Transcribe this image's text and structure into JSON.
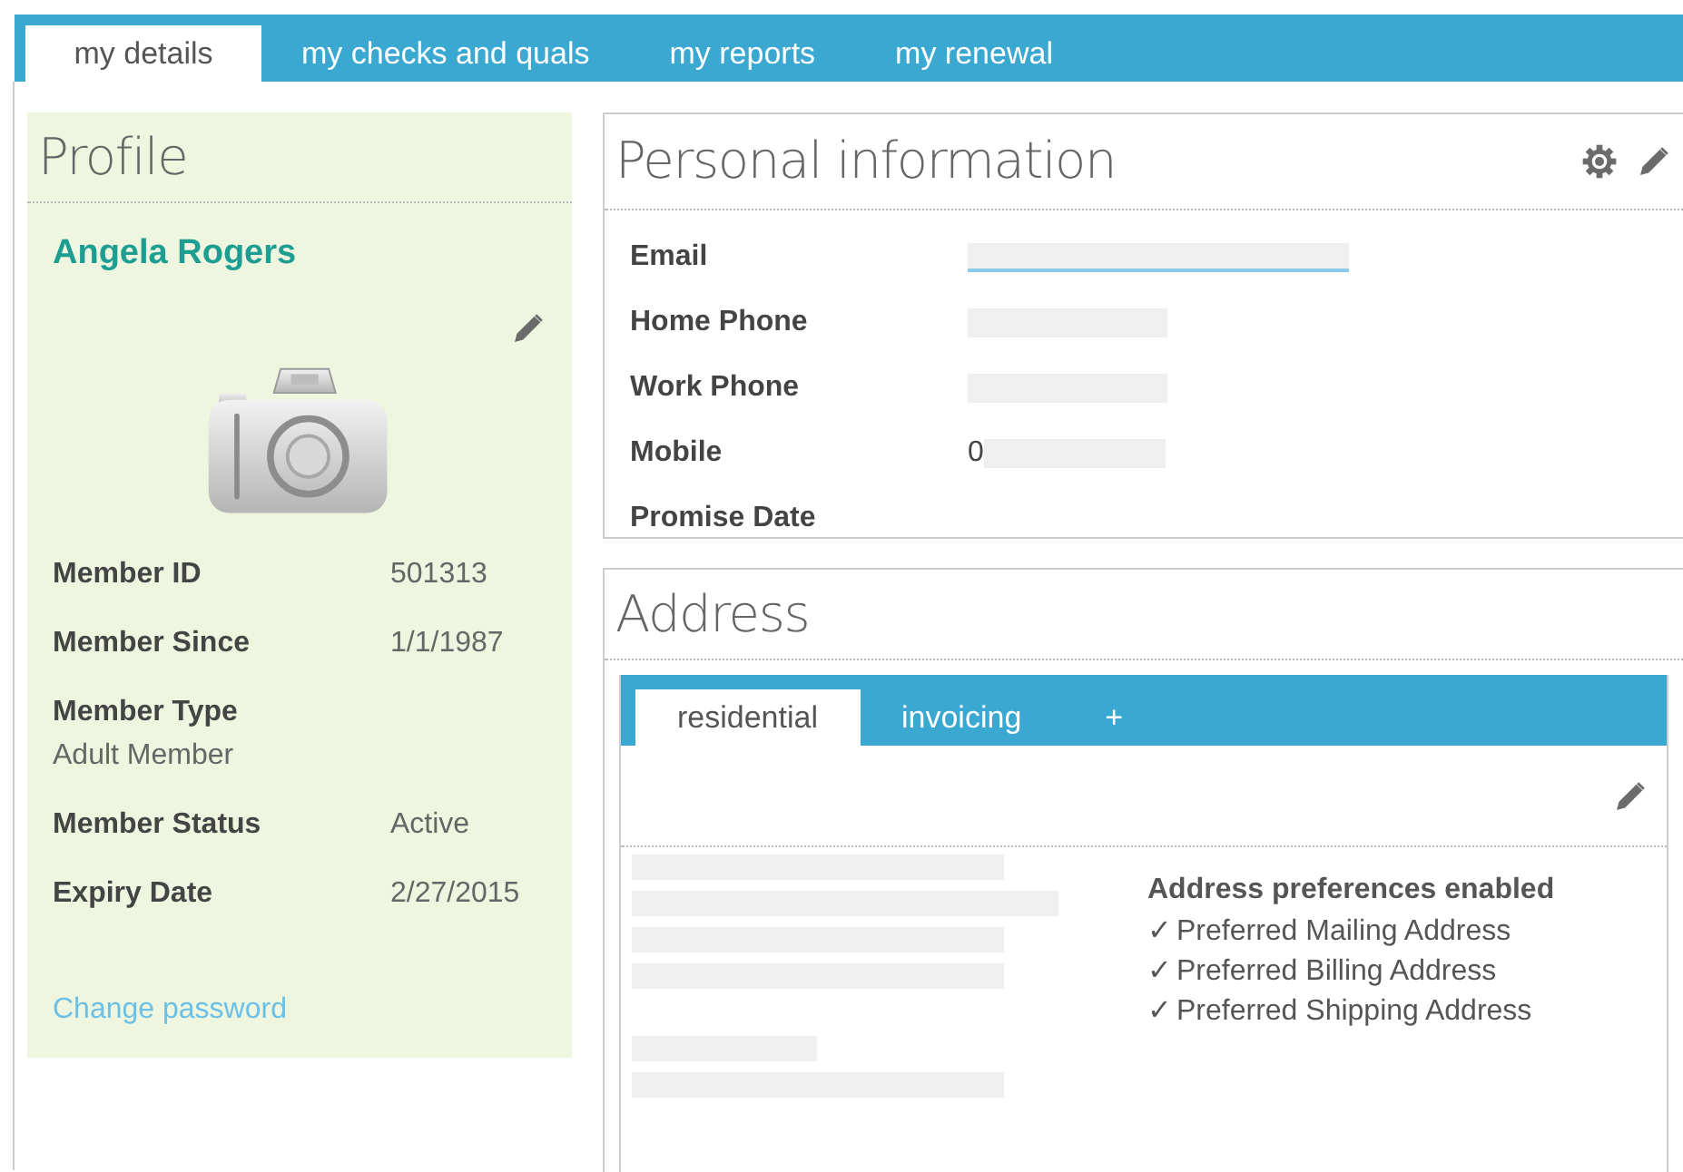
{
  "tabs": [
    {
      "label": "my details",
      "selected": true
    },
    {
      "label": "my checks and quals",
      "selected": false
    },
    {
      "label": "my reports",
      "selected": false
    },
    {
      "label": "my renewal",
      "selected": false
    }
  ],
  "profile": {
    "title": "Profile",
    "name": "Angela Rogers",
    "fields": [
      {
        "label": "Member ID",
        "value": "501313",
        "kind": "inline"
      },
      {
        "label": "Member Since",
        "value": "1/1/1987",
        "kind": "inline"
      },
      {
        "label": "Member Type",
        "value": "Adult Member",
        "kind": "stacked"
      },
      {
        "label": "Member Status",
        "value": "Active",
        "kind": "inline"
      },
      {
        "label": "Expiry Date",
        "value": "2/27/2015",
        "kind": "inline"
      }
    ],
    "link": "Change password"
  },
  "personal": {
    "title": "Personal information",
    "fields": [
      {
        "label": "Email",
        "value": {
          "kind": "redacted"
        }
      },
      {
        "label": "Home Phone",
        "value": {
          "kind": "redacted"
        }
      },
      {
        "label": "Work Phone",
        "value": {
          "kind": "redacted"
        }
      },
      {
        "label": "Mobile",
        "value": {
          "kind": "redacted",
          "text": "0"
        }
      },
      {
        "label": "Promise Date"
      }
    ]
  },
  "address": {
    "title": "Address",
    "tabs": [
      {
        "label": "residential",
        "selected": true
      },
      {
        "label": "invoicing",
        "selected": false
      },
      {
        "label": "+",
        "selected": false
      }
    ],
    "lines": [
      {
        "kind": "redacted"
      },
      {
        "kind": "redacted"
      },
      {
        "kind": "redacted"
      },
      {
        "kind": "redacted"
      },
      {
        "kind": "gap"
      },
      {
        "kind": "redacted"
      },
      {
        "kind": "redacted"
      }
    ],
    "preferences": {
      "title": "Address preferences enabled",
      "items": [
        {
          "mark": "✓",
          "label": "Preferred Mailing Address"
        },
        {
          "mark": "✓",
          "label": "Preferred Billing Address"
        },
        {
          "mark": "✓",
          "label": "Preferred Shipping Address"
        }
      ]
    }
  }
}
